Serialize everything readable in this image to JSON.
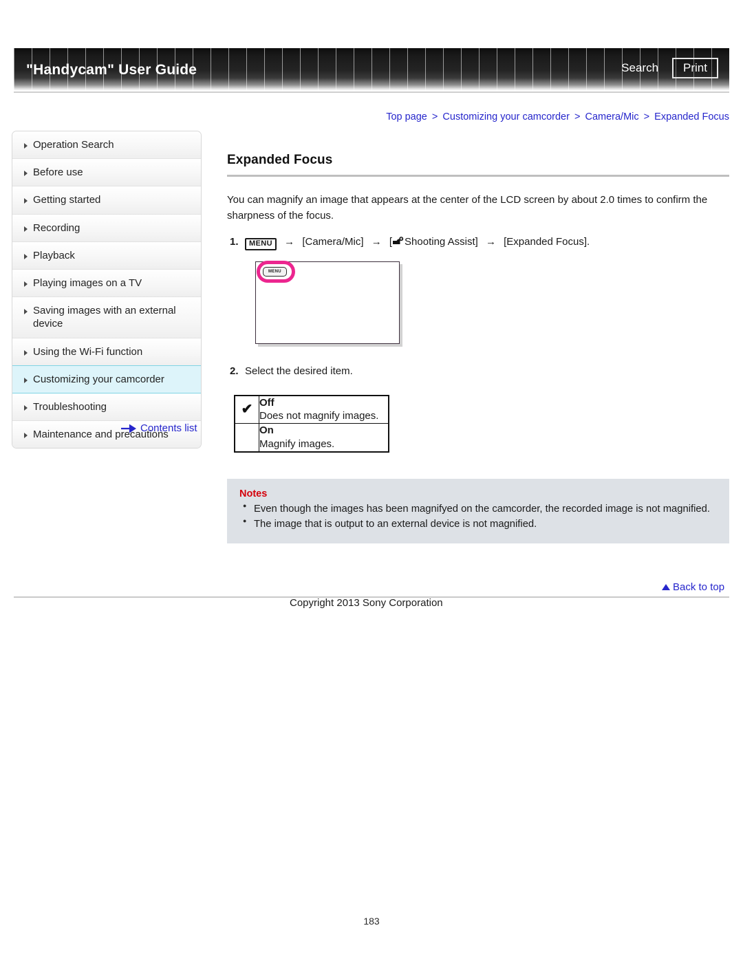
{
  "header": {
    "title": "\"Handycam\" User Guide",
    "search_label": "Search",
    "print_label": "Print"
  },
  "breadcrumb": {
    "items": [
      "Top page",
      "Customizing your camcorder",
      "Camera/Mic",
      "Expanded Focus"
    ],
    "separator": ">",
    "color": "#2626cc"
  },
  "sidebar": {
    "items": [
      {
        "label": "Operation Search",
        "active": false
      },
      {
        "label": "Before use",
        "active": false
      },
      {
        "label": "Getting started",
        "active": false
      },
      {
        "label": "Recording",
        "active": false
      },
      {
        "label": "Playback",
        "active": false
      },
      {
        "label": "Playing images on a TV",
        "active": false
      },
      {
        "label": "Saving images with an external device",
        "active": false
      },
      {
        "label": "Using the Wi-Fi function",
        "active": false
      },
      {
        "label": "Customizing your camcorder",
        "active": true
      },
      {
        "label": "Troubleshooting",
        "active": false
      },
      {
        "label": "Maintenance and precautions",
        "active": false
      }
    ],
    "active_background": "#ddf4fa",
    "active_border": "#7fd4e4",
    "contents_link": "Contents list"
  },
  "main": {
    "title": "Expanded Focus",
    "intro": "You can magnify an image that appears at the center of the LCD screen by about 2.0 times to confirm the sharpness of the focus.",
    "steps": [
      {
        "number": "1.",
        "menu_chip": "MENU",
        "arrow": "→",
        "part1": "[Camera/Mic]",
        "bracket_open": "[",
        "part2": "Shooting Assist]",
        "part3": "[Expanded Focus]."
      },
      {
        "number": "2.",
        "text": "Select the desired item."
      }
    ],
    "illustration": {
      "menu_label": "MENU",
      "highlight_color": "#ec268f"
    },
    "options": [
      {
        "checked": "✔",
        "name": "Off",
        "description": "Does not magnify images."
      },
      {
        "checked": "",
        "name": "On",
        "description": "Magnify images."
      }
    ],
    "notes": {
      "title": "Notes",
      "color": "#d4000b",
      "background": "#dde1e6",
      "items": [
        "Even though the images has been magnifyed on the camcorder, the recorded image is not magnified.",
        "The image that is output to an external device is not magnified."
      ]
    }
  },
  "footer": {
    "back_to_top": "Back to top",
    "copyright": "Copyright 2013 Sony Corporation",
    "page_number": "183"
  }
}
